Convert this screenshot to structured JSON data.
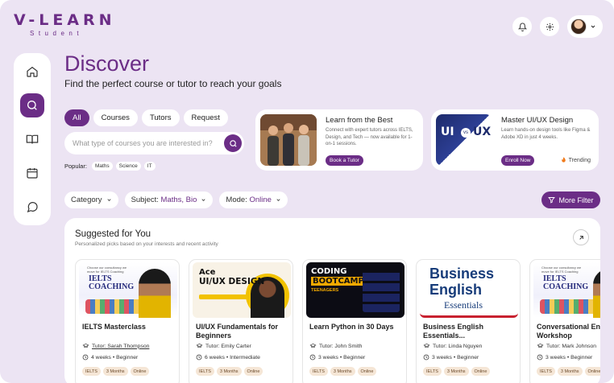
{
  "app": {
    "logo_title": "V-LEARN",
    "logo_subtitle": "Student",
    "accent_color": "#6b2d86",
    "background_color": "#ece4f3"
  },
  "header": {
    "icons": [
      "bell-icon",
      "gear-icon",
      "avatar",
      "chevron-down-icon"
    ]
  },
  "sidebar": {
    "items": [
      {
        "name": "home",
        "icon": "home-icon",
        "active": false
      },
      {
        "name": "discover",
        "icon": "search-icon",
        "active": true
      },
      {
        "name": "courses",
        "icon": "book-icon",
        "active": false
      },
      {
        "name": "calendar",
        "icon": "calendar-icon",
        "active": false
      },
      {
        "name": "messages",
        "icon": "chat-icon",
        "active": false
      }
    ]
  },
  "hero": {
    "title": "Discover",
    "subtitle": "Find the perfect course or tutor to reach your goals"
  },
  "tabs": [
    "All",
    "Courses",
    "Tutors",
    "Request"
  ],
  "search": {
    "placeholder": "What type of courses you are interested in?"
  },
  "popular": {
    "label": "Popular:",
    "tags": [
      "Maths",
      "Science",
      "IT"
    ]
  },
  "promos": [
    {
      "title": "Learn from the Best",
      "description": "Connect with expert tutors across IELTS, Design, and Tech — now available for 1-on-1 sessions.",
      "button": "Book a Tutor"
    },
    {
      "title": "Master UI/UX Design",
      "description": "Learn hands-on design tools like Figma & Adobe XD in just 4 weeks.",
      "button": "Enroll Now",
      "badge": "Trending",
      "image_text_left": "UI",
      "image_text_vs": "vs",
      "image_text_right": "UX"
    }
  ],
  "filters": {
    "category": "Category",
    "subject_label": "Subject:",
    "subject_value": "Maths, Bio",
    "mode_label": "Mode:",
    "mode_value": "Online",
    "more": "More Filter"
  },
  "suggested": {
    "title": "Suggested for You",
    "subtitle": "Personalized picks based on your interests and recent activity",
    "cards": [
      {
        "title": "IELTS Masterclass",
        "tutor": "Tutor: Sarah Thompson",
        "meta": "4 weeks • Beginner",
        "tags": [
          "IELTS",
          "3 Months",
          "Online"
        ],
        "art": {
          "big1": "IELTS",
          "big2": "COACHING",
          "small": "Choose our consultancy we move for IELTS Coaching"
        }
      },
      {
        "title": "UI/UX Fundamentals for Beginners",
        "tutor": "Tutor: Emily Carter",
        "meta": "6 weeks • Intermediate",
        "tags": [
          "IELTS",
          "3 Months",
          "Online"
        ],
        "art": {
          "t1": "Ace",
          "t2": "UI/UX DESIGN"
        }
      },
      {
        "title": "Learn Python in 30 Days",
        "tutor": "Tutor: John Smith",
        "meta": "3 weeks • Beginner",
        "tags": [
          "IELTS",
          "3 Months",
          "Online"
        ],
        "art": {
          "t1": "CODING",
          "t2": "BOOTCAMP",
          "t3": "TEENAGERS"
        }
      },
      {
        "title": "Business English Essentials...",
        "tutor": "Tutor: Linda Nguyen",
        "meta": "3 weeks • Beginner",
        "tags": [
          "IELTS",
          "3 Months",
          "Online"
        ],
        "art": {
          "b1": "Business",
          "b2": "English",
          "b3": "Essentials"
        }
      },
      {
        "title": "Conversational English Workshop",
        "tutor": "Tutor: Mark Johnson",
        "meta": "3 weeks • Beginner",
        "tags": [
          "IELTS",
          "3 Months",
          "Online"
        ],
        "art": {
          "big1": "IELTS",
          "big2": "COACHING",
          "small": "Choose our consultancy we move for IELTS Coaching"
        }
      }
    ]
  }
}
